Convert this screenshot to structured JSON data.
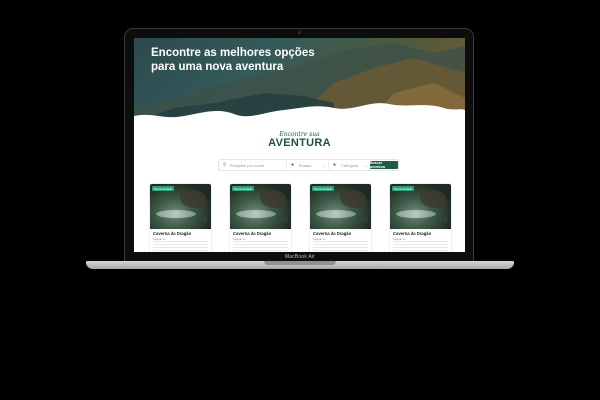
{
  "device": {
    "label": "MacBook Air"
  },
  "site": {
    "hero_title": "Encontre as melhores opções para uma nova aventura",
    "logo_top": "Encontre sua",
    "logo_main": "AVENTURA"
  },
  "search": {
    "placeholder": "Pesquise por nome",
    "state_label": "Estado",
    "category_label": "Categoria",
    "button_label": "Buscar aventura"
  },
  "cards": [
    {
      "badge": "Recomendado",
      "title": "Caverna da Dragão",
      "location": "Lagoa, rs"
    },
    {
      "badge": "Recomendado",
      "title": "Caverna da Dragão",
      "location": "Lagoa, rs"
    },
    {
      "badge": "Recomendado",
      "title": "Caverna da Dragão",
      "location": "Lagoa, rs"
    },
    {
      "badge": "Recomendado",
      "title": "Caverna da Dragão",
      "location": "Lagoa, rs"
    }
  ],
  "colors": {
    "brand_green": "#1d5a48",
    "badge_green": "#2f9e77",
    "heart_red": "#e35050"
  }
}
